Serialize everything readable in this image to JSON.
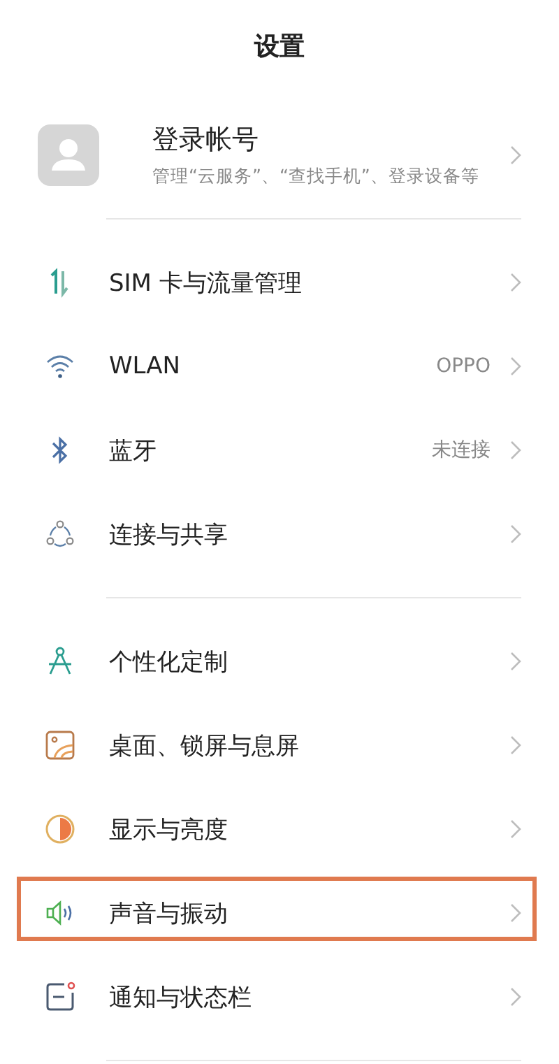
{
  "header": {
    "title": "设置"
  },
  "account": {
    "name": "登录帐号",
    "subtitle": "管理“云服务”、“查找手机”、登录设备等"
  },
  "groups": [
    {
      "items": [
        {
          "kind": "sim",
          "label": "SIM 卡与流量管理",
          "highlighted": false
        },
        {
          "kind": "wifi",
          "label": "WLAN",
          "value": "OPPO",
          "highlighted": false
        },
        {
          "kind": "bluetooth",
          "label": "蓝牙",
          "value": "未连接",
          "highlighted": false
        },
        {
          "kind": "share",
          "label": "连接与共享",
          "highlighted": false
        }
      ]
    },
    {
      "items": [
        {
          "kind": "compass",
          "label": "个性化定制",
          "highlighted": false
        },
        {
          "kind": "wallpaper",
          "label": "桌面、锁屏与息屏",
          "highlighted": false
        },
        {
          "kind": "display",
          "label": "显示与亮度",
          "highlighted": false
        },
        {
          "kind": "sound",
          "label": "声音与振动",
          "highlighted": true
        },
        {
          "kind": "notification",
          "label": "通知与状态栏",
          "highlighted": false
        }
      ]
    }
  ]
}
